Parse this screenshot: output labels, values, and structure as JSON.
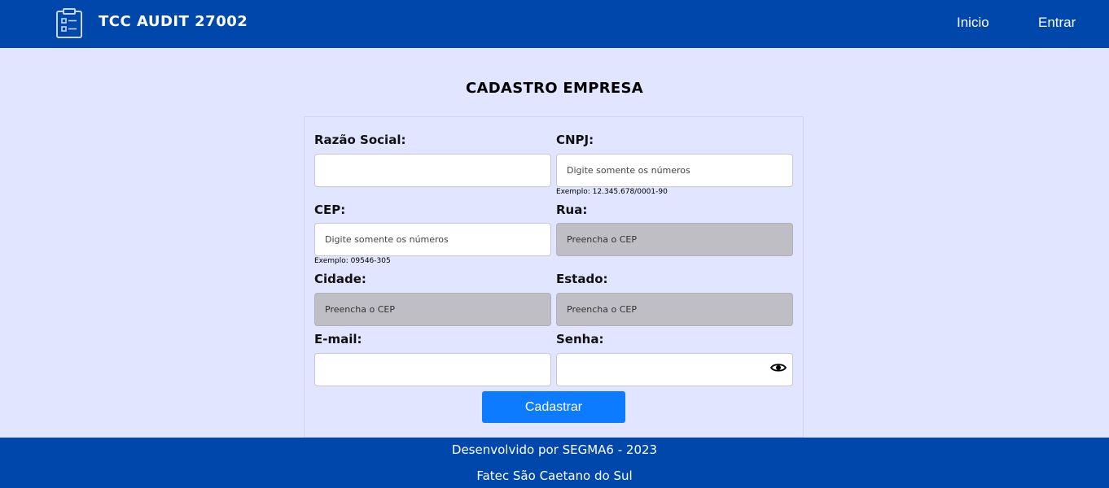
{
  "header": {
    "brand": "TCC AUDIT 27002",
    "brand_icon": "clipboard-checklist-icon",
    "nav": {
      "inicio": "Inicio",
      "entrar": "Entrar"
    },
    "color": "#0047ab"
  },
  "page": {
    "title": "CADASTRO EMPRESA",
    "background": "#e1e5ff"
  },
  "form": {
    "razao_social": {
      "label": "Razão Social:",
      "value": "",
      "placeholder": ""
    },
    "cnpj": {
      "label": "CNPJ:",
      "value": "",
      "placeholder": "Digite somente os números",
      "hint": "Exemplo: 12.345.678/0001-90"
    },
    "cep": {
      "label": "CEP:",
      "value": "",
      "placeholder": "Digite somente os números",
      "hint": "Exemplo: 09546-305"
    },
    "rua": {
      "label": "Rua:",
      "value": "",
      "placeholder": "Preencha o CEP"
    },
    "cidade": {
      "label": "Cidade:",
      "value": "",
      "placeholder": "Preencha o CEP"
    },
    "estado": {
      "label": "Estado:",
      "value": "",
      "placeholder": "Preencha o CEP"
    },
    "email": {
      "label": "E-mail:",
      "value": "",
      "placeholder": ""
    },
    "senha": {
      "label": "Senha:",
      "value": "",
      "placeholder": "",
      "toggle_icon": "eye-icon"
    },
    "submit_label": "Cadastrar",
    "submit_color": "#0d7bff"
  },
  "footer": {
    "line1": "Desenvolvido por SEGMA6 - 2023",
    "line2": "Fatec São Caetano do Sul"
  }
}
